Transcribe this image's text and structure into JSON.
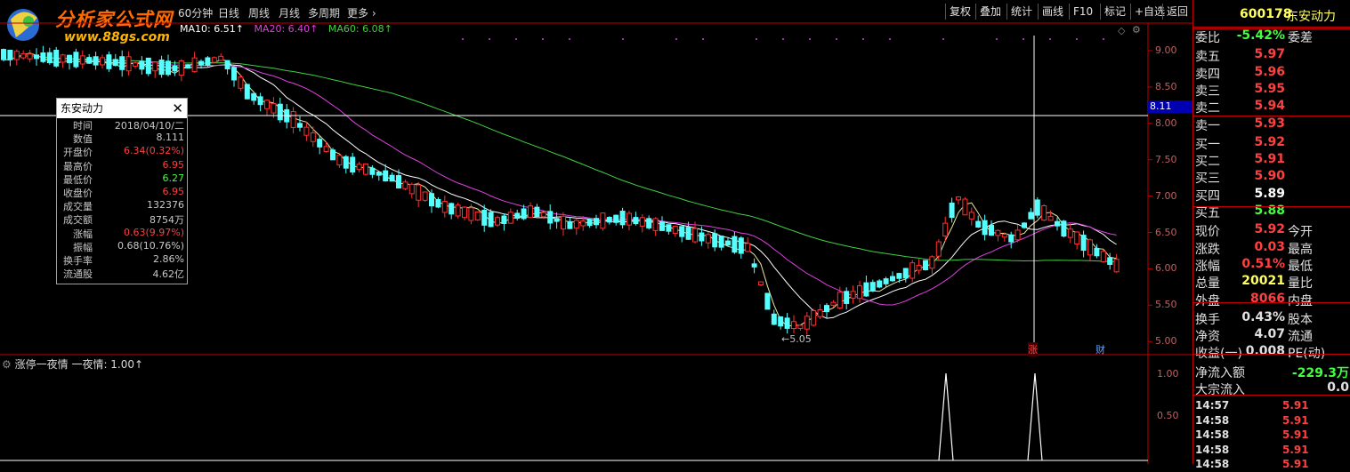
{
  "logo": {
    "name": "分析家公式网",
    "url": "www.88gs.com"
  },
  "toolbar": {
    "periods": [
      "60分钟",
      "日线",
      "周线",
      "月线",
      "多周期",
      "更多"
    ],
    "buttons": [
      "复权",
      "叠加",
      "统计",
      "画线",
      "F10",
      "标记",
      "+自选",
      "返回"
    ]
  },
  "ma_legend": [
    {
      "label": "MA10: 6.51↑",
      "color": "#ffffff"
    },
    {
      "label": "MA20: 6.40↑",
      "color": "#e040e0"
    },
    {
      "label": "MA60: 6.08↑",
      "color": "#40d040"
    }
  ],
  "popup": {
    "title": "东安动力",
    "rows": [
      {
        "k": "时间",
        "v": "2018/04/10/二",
        "c": "#c8c8c8"
      },
      {
        "k": "数值",
        "v": "8.111",
        "c": "#c8c8c8"
      },
      {
        "k": "开盘价",
        "v": "6.34(0.32%)",
        "c": "#ff4040"
      },
      {
        "k": "最高价",
        "v": "6.95",
        "c": "#ff4040"
      },
      {
        "k": "最低价",
        "v": "6.27",
        "c": "#40ff40"
      },
      {
        "k": "收盘价",
        "v": "6.95",
        "c": "#ff4040"
      },
      {
        "k": "成交量",
        "v": "132376",
        "c": "#c8c8c8"
      },
      {
        "k": "成交额",
        "v": "8754万",
        "c": "#c8c8c8"
      },
      {
        "k": "涨幅",
        "v": "0.63(9.97%)",
        "c": "#ff4040"
      },
      {
        "k": "振幅",
        "v": "0.68(10.76%)",
        "c": "#c8c8c8"
      },
      {
        "k": "换手率",
        "v": "2.86%",
        "c": "#c8c8c8"
      },
      {
        "k": "流通股",
        "v": "4.62亿",
        "c": "#c8c8c8"
      }
    ]
  },
  "price_axis": [
    "9.00",
    "8.50",
    "8.00",
    "7.50",
    "7.00",
    "6.50",
    "6.00",
    "5.50",
    "5.00"
  ],
  "crosshair_value": "8.11",
  "low_marker": "←5.05",
  "event_markers": [
    "涨",
    "财"
  ],
  "sub_legend": {
    "name": "涨停一夜情",
    "indicator": "一夜情: 1.00↑"
  },
  "sub_axis": [
    "1.00",
    "0.50"
  ],
  "panel": {
    "code": "600178",
    "name": "东安动力",
    "weibi": {
      "k": "委比",
      "v": "-5.42%",
      "k2": "委差"
    },
    "asks": [
      {
        "k": "卖五",
        "v": "5.97"
      },
      {
        "k": "卖四",
        "v": "5.96"
      },
      {
        "k": "卖三",
        "v": "5.95"
      },
      {
        "k": "卖二",
        "v": "5.94"
      },
      {
        "k": "卖一",
        "v": "5.93"
      }
    ],
    "bids": [
      {
        "k": "买一",
        "v": "5.92",
        "c": "#ff4040"
      },
      {
        "k": "买二",
        "v": "5.91",
        "c": "#ff4040"
      },
      {
        "k": "买三",
        "v": "5.90",
        "c": "#ff4040"
      },
      {
        "k": "买四",
        "v": "5.89",
        "c": "#ffffff"
      },
      {
        "k": "买五",
        "v": "5.88",
        "c": "#40ff40"
      }
    ],
    "quote": [
      {
        "k": "现价",
        "v": "5.92",
        "c": "#ff4040",
        "k2": "今开"
      },
      {
        "k": "涨跌",
        "v": "0.03",
        "c": "#ff4040",
        "k2": "最高"
      },
      {
        "k": "涨幅",
        "v": "0.51%",
        "c": "#ff4040",
        "k2": "最低"
      },
      {
        "k": "总量",
        "v": "20021",
        "c": "#ffff60",
        "k2": "量比"
      },
      {
        "k": "外盘",
        "v": "8066",
        "c": "#ff4040",
        "k2": "内盘"
      }
    ],
    "extra": [
      {
        "k": "换手",
        "v": "0.43%",
        "c": "#e0e0e0",
        "k2": "股本"
      },
      {
        "k": "净资",
        "v": "4.07",
        "c": "#e0e0e0",
        "k2": "流通"
      },
      {
        "k": "收益(一)",
        "v": "0.008",
        "c": "#e0e0e0",
        "k2": "PE(动)"
      }
    ],
    "flows": [
      {
        "k": "净流入额",
        "v": "-229.3万",
        "c": "#40ff40"
      },
      {
        "k": "大宗流入",
        "v": "0.0",
        "c": "#e0e0e0"
      }
    ],
    "ticks": [
      {
        "t": "14:57",
        "p": "5.91"
      },
      {
        "t": "14:58",
        "p": "5.91"
      },
      {
        "t": "14:58",
        "p": "5.91"
      },
      {
        "t": "14:58",
        "p": "5.91"
      },
      {
        "t": "14:58",
        "p": "5.91"
      }
    ]
  },
  "colors": {
    "up": "#ff3030",
    "down": "#54ffff",
    "ma10": "#ffffff",
    "ma20": "#e040e0",
    "ma60": "#40d040",
    "border": "#c00000"
  }
}
